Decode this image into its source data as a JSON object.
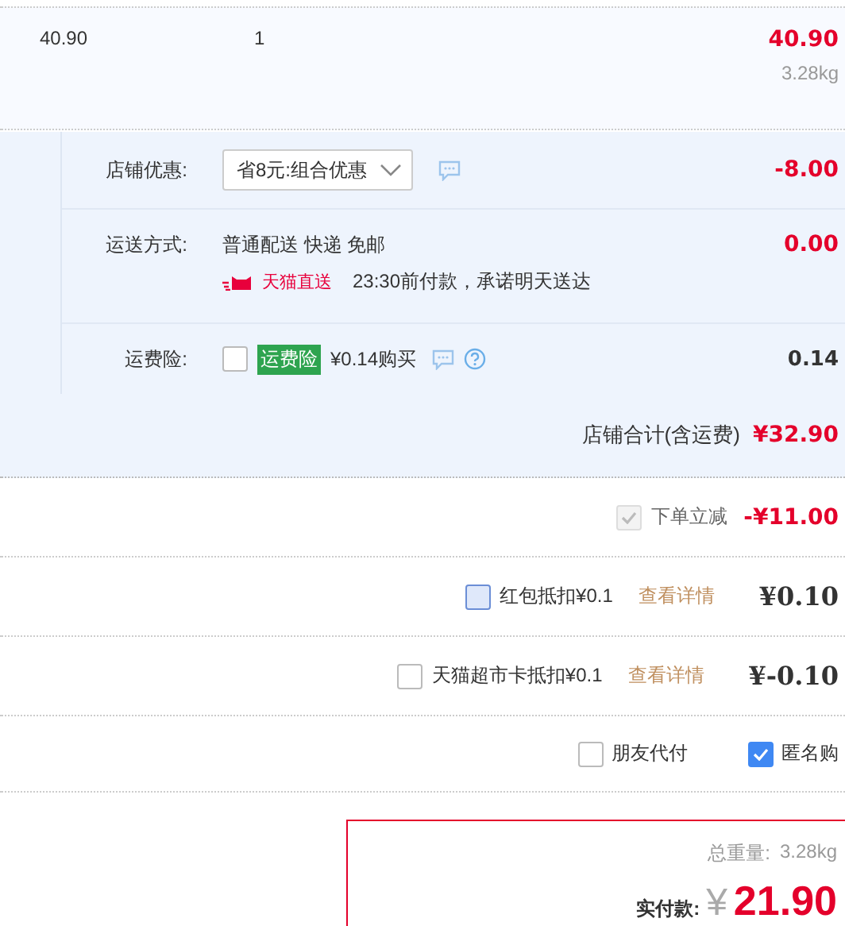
{
  "item": {
    "price": "40.90",
    "quantity": "1",
    "subtotal": "40.90",
    "weight": "3.28kg"
  },
  "store": {
    "discount": {
      "label": "店铺优惠:",
      "select": "省8元:组合优惠",
      "amount": "-8.00"
    },
    "shipping": {
      "label": "运送方式:",
      "method": "普通配送 快递 免邮",
      "badge": "天猫直送",
      "promise": "23:30前付款，承诺明天送达",
      "amount": "0.00"
    },
    "insurance": {
      "label": "运费险:",
      "checked": false,
      "tag": "运费险",
      "price": "¥0.14购买",
      "amount": "0.14"
    },
    "total_label": "店铺合计(含运费)",
    "total": "¥32.90"
  },
  "adjustments": [
    {
      "kind": "instant",
      "checked": true,
      "disabled": true,
      "label": "下单立减",
      "amount": "-¥11.00"
    },
    {
      "kind": "voucher",
      "checked": false,
      "disabled": false,
      "focused": true,
      "label": "红包抵扣¥0.1",
      "link": "查看详情",
      "amount": "¥0.10"
    },
    {
      "kind": "voucher",
      "checked": false,
      "disabled": false,
      "focused": false,
      "label": "天猫超市卡抵扣¥0.1",
      "link": "查看详情",
      "amount": "¥-0.10"
    }
  ],
  "options": [
    {
      "label": "朋友代付",
      "checked": false
    },
    {
      "label": "匿名购",
      "checked": true
    }
  ],
  "summary": {
    "weight_label": "总重量:",
    "weight": "3.28kg",
    "pay_label": "实付款:",
    "currency": "¥",
    "amount": "21.90"
  }
}
